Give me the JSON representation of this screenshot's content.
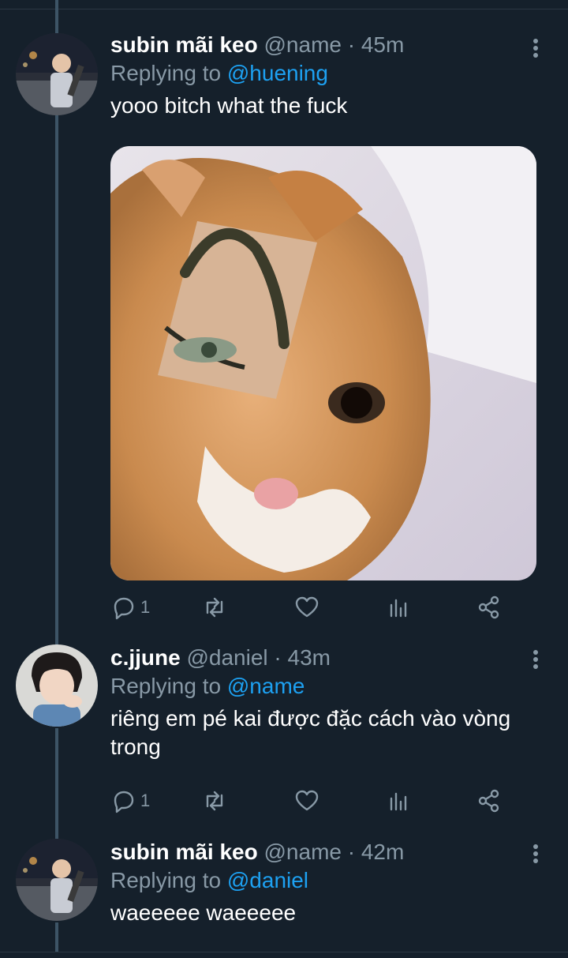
{
  "tweets": [
    {
      "name": "subin mãi keo",
      "handle": "@name",
      "time": "45m",
      "replying_prefix": "Replying to",
      "replying_to": "@huening",
      "text": "yooo bitch what the fuck",
      "has_media": true,
      "reply_count": "1"
    },
    {
      "name": "c.jjune",
      "handle": "@daniel",
      "time": "43m",
      "replying_prefix": "Replying to",
      "replying_to": "@name",
      "text": "riêng em pé kai được đặc cách vào vòng trong",
      "has_media": false,
      "reply_count": "1"
    },
    {
      "name": "subin mãi keo",
      "handle": "@name",
      "time": "42m",
      "replying_prefix": "Replying to",
      "replying_to": "@daniel",
      "text": "waeeeee waeeeee",
      "has_media": false
    }
  ],
  "separator": "·",
  "colors": {
    "background": "#15202b",
    "secondary_text": "#8899a6",
    "link": "#1da1f2",
    "thread_line": "#3d5466"
  },
  "icons": [
    "reply-icon",
    "retweet-icon",
    "like-icon",
    "analytics-icon",
    "share-icon",
    "more-icon"
  ]
}
